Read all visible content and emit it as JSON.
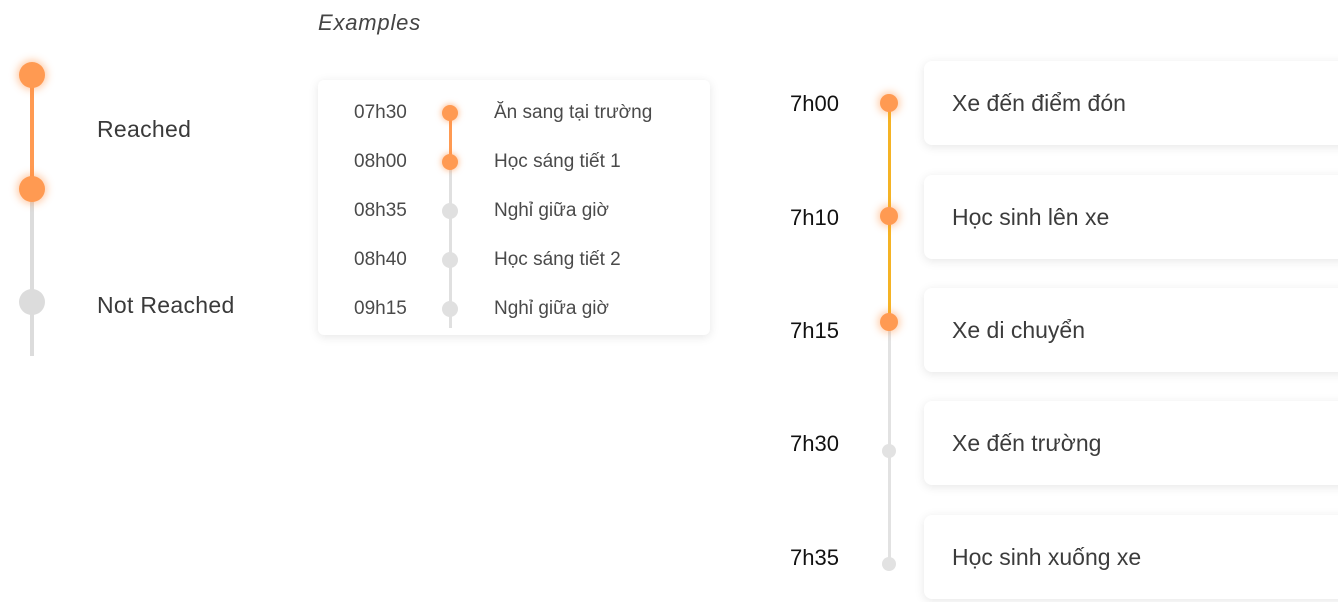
{
  "legend": {
    "reached_label": "Reached",
    "not_reached_label": "Not Reached",
    "reached_color": "#ff9a52",
    "not_reached_color": "#dcdcdc"
  },
  "examples_title": "Examples",
  "compact_timeline": [
    {
      "time": "07h30",
      "label": "Ăn sang tại trường",
      "status": "reached"
    },
    {
      "time": "08h00",
      "label": "Học sáng tiết 1",
      "status": "reached"
    },
    {
      "time": "08h35",
      "label": "Nghỉ giữa giờ",
      "status": "not_reached"
    },
    {
      "time": "08h40",
      "label": "Học sáng tiết 2",
      "status": "not_reached"
    },
    {
      "time": "09h15",
      "label": "Nghỉ giữa giờ",
      "status": "not_reached"
    }
  ],
  "bus_timeline": [
    {
      "time": "7h00",
      "label": "Xe đến điểm đón",
      "status": "reached"
    },
    {
      "time": "7h10",
      "label": "Học sinh lên xe",
      "status": "reached"
    },
    {
      "time": "7h15",
      "label": "Xe di chuyển",
      "status": "reached"
    },
    {
      "time": "7h30",
      "label": "Xe đến trường",
      "status": "not_reached"
    },
    {
      "time": "7h35",
      "label": "Học sinh xuống xe",
      "status": "not_reached"
    }
  ],
  "colors": {
    "accent_orange": "#ff9a52",
    "progress_line": "#f5b324",
    "inactive_gray": "#dcdcdc"
  }
}
